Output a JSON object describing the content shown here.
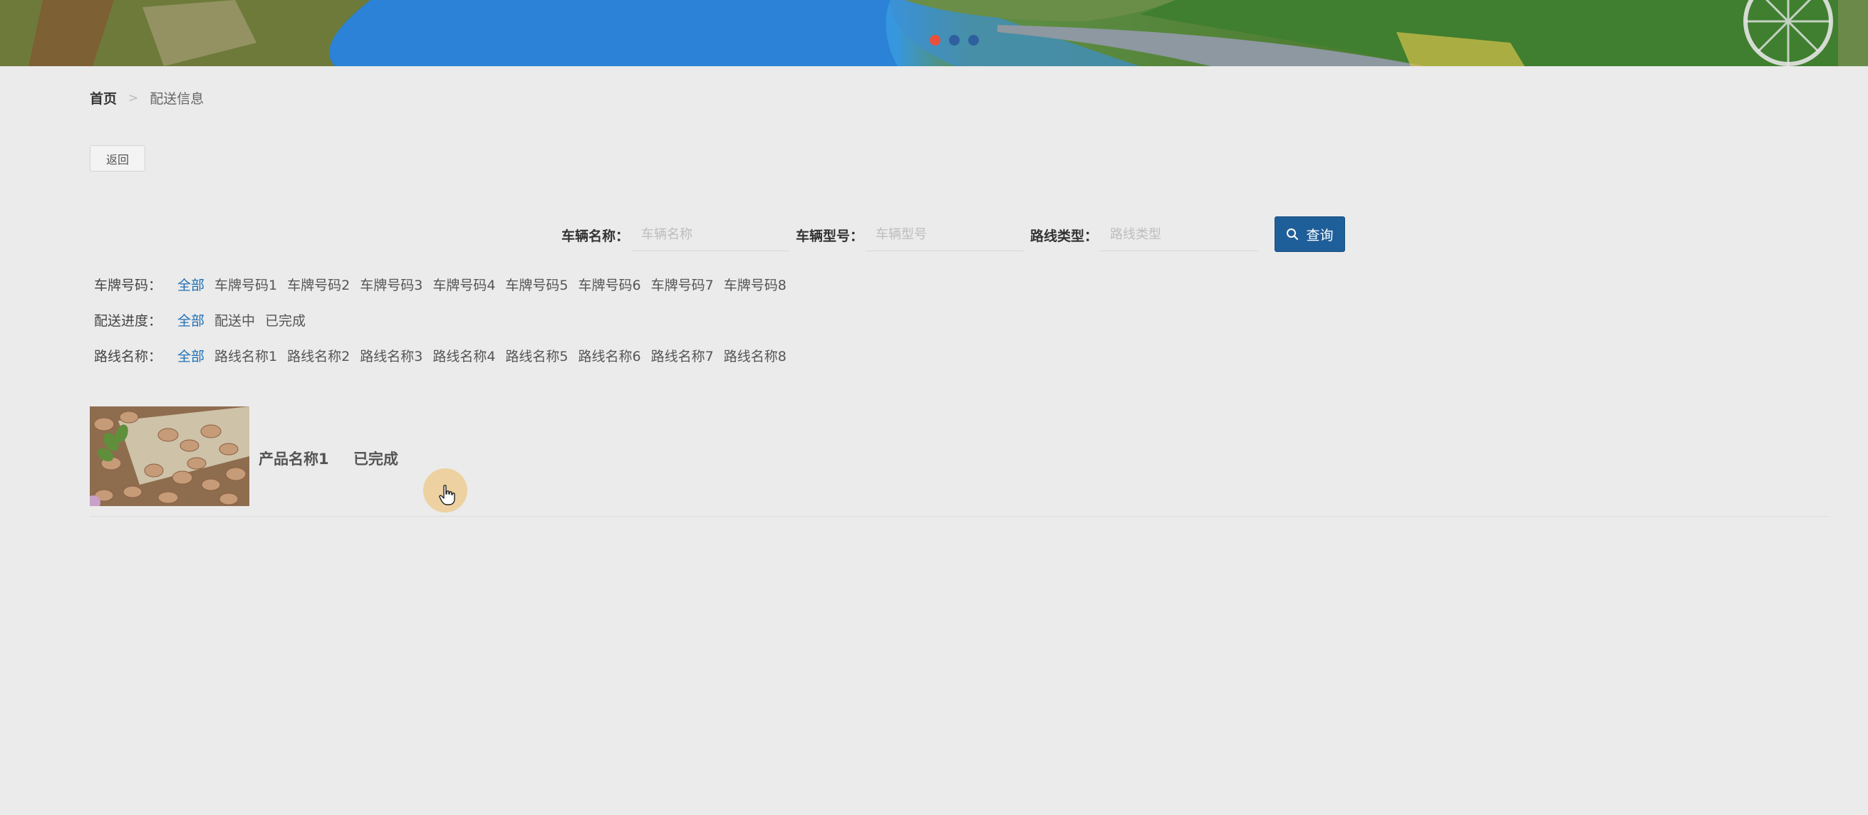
{
  "banner": {
    "carousel_dots": 3,
    "active_dot": 0,
    "colors": {
      "active": "#e9503c",
      "inactive": "#2e5f9f"
    }
  },
  "breadcrumb": {
    "home": "首页",
    "separator": ">",
    "current": "配送信息"
  },
  "back_button": {
    "label": "返回"
  },
  "search": {
    "fields": [
      {
        "label": "车辆名称：",
        "placeholder": "车辆名称"
      },
      {
        "label": "车辆型号：",
        "placeholder": "车辆型号"
      },
      {
        "label": "路线类型：",
        "placeholder": "路线类型"
      }
    ],
    "button_label": "查询",
    "button_icon": "search-icon",
    "button_color": "#1f5f99"
  },
  "filters": [
    {
      "label": "车牌号码：",
      "options": [
        "全部",
        "车牌号码1",
        "车牌号码2",
        "车牌号码3",
        "车牌号码4",
        "车牌号码5",
        "车牌号码6",
        "车牌号码7",
        "车牌号码8"
      ],
      "active": 0
    },
    {
      "label": "配送进度：",
      "options": [
        "全部",
        "配送中",
        "已完成"
      ],
      "active": 0
    },
    {
      "label": "路线名称：",
      "options": [
        "全部",
        "路线名称1",
        "路线名称2",
        "路线名称3",
        "路线名称4",
        "路线名称5",
        "路线名称6",
        "路线名称7",
        "路线名称8"
      ],
      "active": 0
    }
  ],
  "products": [
    {
      "name": "产品名称1",
      "status": "已完成"
    }
  ],
  "accent_color": "#1f6fb5"
}
